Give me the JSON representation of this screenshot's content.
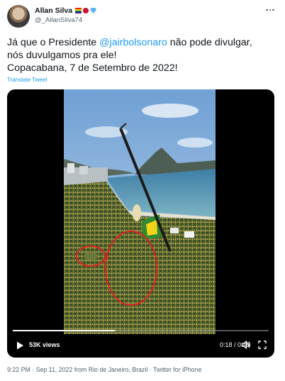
{
  "author": {
    "display_name": "Allan Silva",
    "handle": "@_AllanSilva74",
    "emoji_icons": [
      "rainbow-flag-icon",
      "boxing-glove-icon",
      "gem-icon"
    ]
  },
  "tweet": {
    "text_before_mention": "Já que o Presidente ",
    "mention": "@jairbolsonaro",
    "text_after_mention": " não pode divulgar,",
    "line2": "nós duvulgamos pra ele!",
    "line3": "Copacabana, 7 de Setembro de 2022!",
    "translate_label": "Translate Tweet"
  },
  "video": {
    "views_label": "53K views",
    "time_label": "0:18 / 0:45",
    "progress": 0.4,
    "annotation_color": "#e02020"
  },
  "footer": {
    "meta": "9:22 PM · Sep 11, 2022 from Rio de Janeiro, Brazil · Twitter for iPhone"
  },
  "colors": {
    "accent": "#1d9bf0",
    "secondary_text": "#536471"
  }
}
